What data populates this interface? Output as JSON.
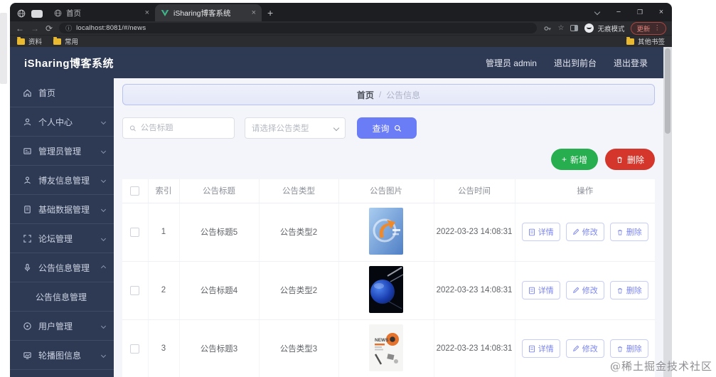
{
  "browser": {
    "tabs": [
      {
        "title": "首页",
        "active": false
      },
      {
        "title": "iSharing博客系统",
        "active": true
      }
    ],
    "url": "localhost:8081/#/news",
    "incognito_label": "无痕模式",
    "update_label": "更新",
    "bookmarks": {
      "item1": "资料",
      "item2": "常用",
      "other": "其他书签"
    }
  },
  "glyphs": {
    "back": "←",
    "forward": "→",
    "refresh": "⟳",
    "info": "ⓘ",
    "star": "☆",
    "menu_dots": "⋮",
    "close": "×",
    "minimize": "−",
    "new_tab": "+",
    "plus": "+"
  },
  "app": {
    "title": "iSharing博客系统",
    "header_right": {
      "user": "管理员 admin",
      "to_front": "退出到前台",
      "logout": "退出登录"
    },
    "sidebar": {
      "items": [
        {
          "label": "首页"
        },
        {
          "label": "个人中心"
        },
        {
          "label": "管理员管理"
        },
        {
          "label": "博友信息管理"
        },
        {
          "label": "基础数据管理"
        },
        {
          "label": "论坛管理"
        },
        {
          "label": "公告信息管理"
        },
        {
          "label": "用户管理"
        },
        {
          "label": "轮播图信息"
        }
      ],
      "submenu": {
        "label": "公告信息管理"
      }
    },
    "breadcrumb": {
      "home": "首页",
      "separator": "/",
      "current": "公告信息"
    },
    "filters": {
      "search_placeholder": "公告标题",
      "type_placeholder": "请选择公告类型",
      "query_label": "查询"
    },
    "actions": {
      "add": "新增",
      "delete": "删除"
    },
    "table": {
      "columns": {
        "index": "索引",
        "title": "公告标题",
        "type": "公告类型",
        "image": "公告图片",
        "time": "公告时间",
        "ops": "操作"
      },
      "row_actions": {
        "detail": "详情",
        "edit": "修改",
        "delete": "删除"
      },
      "rows": [
        {
          "index": "1",
          "title": "公告标题5",
          "type": "公告类型2",
          "time": "2022-03-23 14:08:31"
        },
        {
          "index": "2",
          "title": "公告标题4",
          "type": "公告类型2",
          "time": "2022-03-23 14:08:31"
        },
        {
          "index": "3",
          "title": "公告标题3",
          "type": "公告类型3",
          "time": "2022-03-23 14:08:31"
        }
      ]
    }
  },
  "watermark": "@稀土掘金技术社区",
  "colors": {
    "accent_blue": "#6b7cf7",
    "green": "#27ae4f",
    "red": "#d5362c",
    "navy": "#2e3a54",
    "vue_green": "#41b883",
    "folder_yellow": "#e8b931"
  }
}
